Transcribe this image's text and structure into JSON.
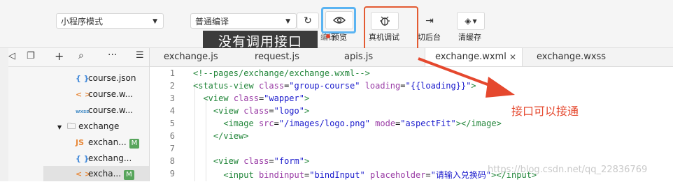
{
  "toolbar": {
    "mode_select": "小程序模式",
    "compile_select": "普通编译",
    "preview_label": "预览",
    "debug_label": "真机调试",
    "backend_label": "切后台",
    "clear_cache_label": "清缓存",
    "compile_label_partial": "编译"
  },
  "tooltip_text": "没有调用接口",
  "annotation_text": "接口可以接通",
  "explorer": {
    "items": [
      {
        "icon": "{ }",
        "label": "course.json"
      },
      {
        "icon": "< >",
        "label": "course.w..."
      },
      {
        "icon": "wxss",
        "label": "course.w..."
      },
      {
        "icon": "folder",
        "label": "exchange"
      },
      {
        "icon": "JS",
        "label": "exchan...",
        "badge": "M"
      },
      {
        "icon": "{ }",
        "label": "exchang..."
      },
      {
        "icon": "< >",
        "label": "excha...",
        "badge": "M"
      }
    ]
  },
  "tabs": [
    {
      "label": "exchange.js"
    },
    {
      "label": "request.js"
    },
    {
      "label": "apis.js"
    },
    {
      "label": "exchange.wxml",
      "active": true
    },
    {
      "label": "exchange.wxss"
    }
  ],
  "editor": {
    "line_numbers": [
      "1",
      "2",
      "3",
      "4",
      "5",
      "6",
      "7",
      "8",
      "9"
    ]
  },
  "watermark": "https://blog.csdn.net/qq_22836769",
  "colors": {
    "tooltip_bg": "#3b3b3b",
    "highlight_blue": "#5bb4f2",
    "highlight_red": "#e35b32",
    "annotation": "#e5482e"
  }
}
